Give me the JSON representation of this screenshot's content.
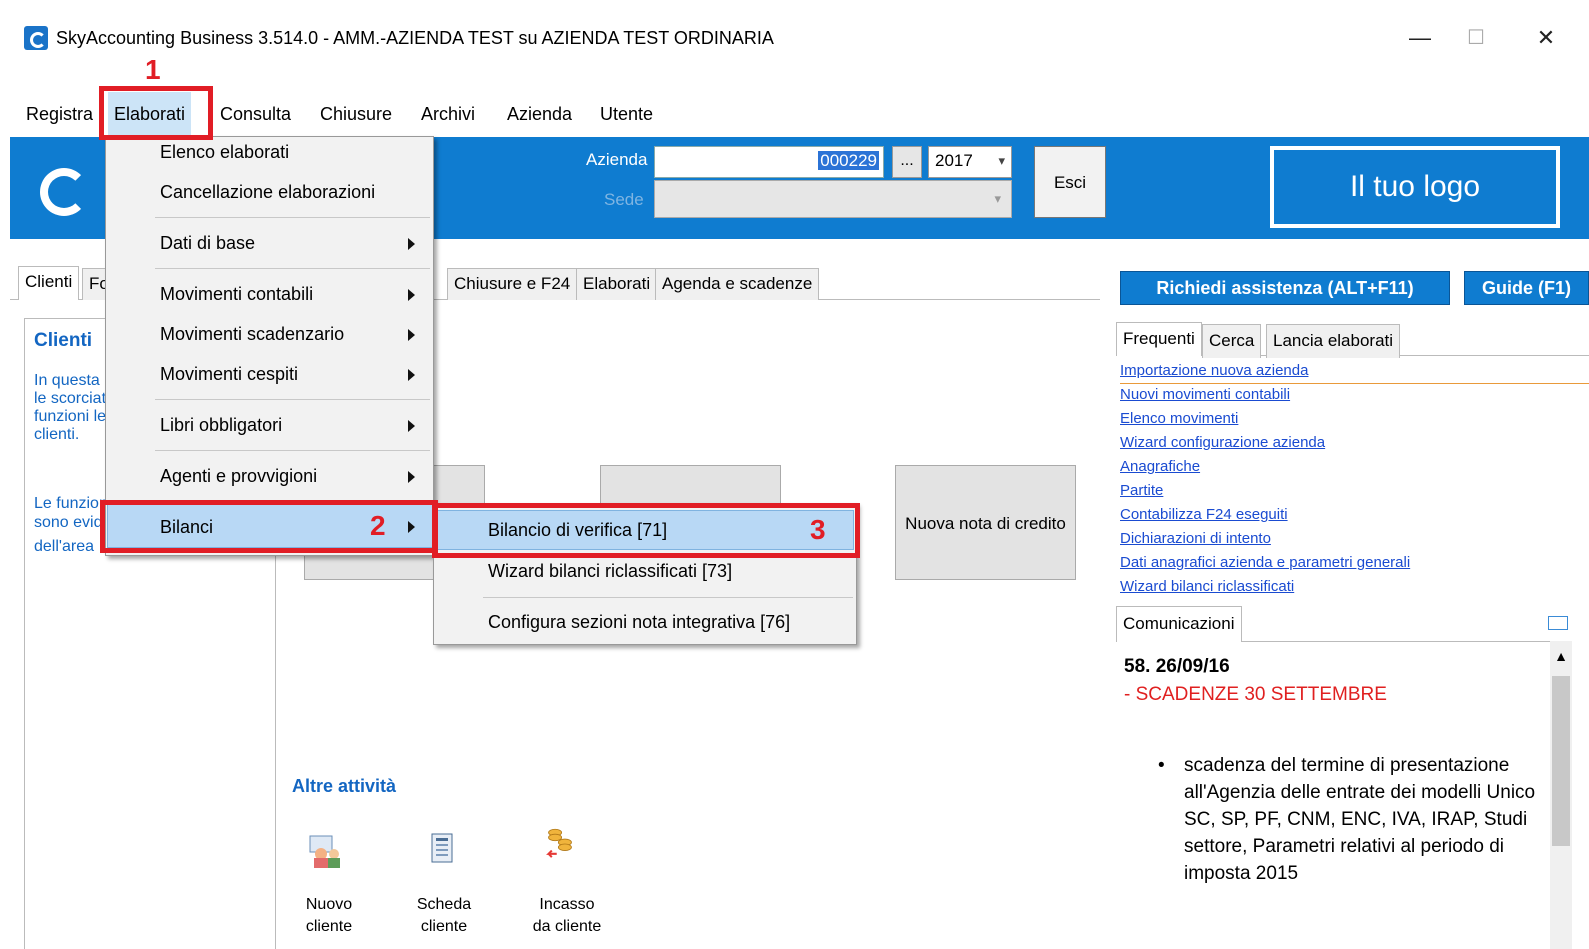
{
  "window": {
    "title": "SkyAccounting Business 3.514.0 - AMM.-AZIENDA TEST su AZIENDA TEST ORDINARIA",
    "minimize": "—",
    "maximize": "☐",
    "close": "✕"
  },
  "menubar": [
    "Registra",
    "Elaborati",
    "Consulta",
    "Chiusure",
    "Archivi",
    "Azienda",
    "Utente"
  ],
  "header": {
    "azienda_label": "Azienda",
    "azienda_value": "000229",
    "dots": "...",
    "year": "2017",
    "sede_label": "Sede",
    "esci": "Esci",
    "logo_text": "Il tuo logo"
  },
  "tabs": {
    "clienti": "Clienti",
    "fo": "Fo",
    "chiusure": "Chiusure e F24",
    "elaborati": "Elaborati",
    "agenda": "Agenda e scadenze"
  },
  "clienti_panel": {
    "heading": "Clienti",
    "lines": [
      "In questa",
      "le scorciat",
      "funzioni le",
      "clienti.",
      "",
      "Le funzion",
      "sono evid",
      "dell'area"
    ]
  },
  "tiles": {
    "nota_credito": "Nuova nota di credito"
  },
  "altre": {
    "heading": "Altre attività",
    "items": [
      {
        "line1": "Nuovo",
        "line2": "cliente"
      },
      {
        "line1": "Scheda",
        "line2": "cliente"
      },
      {
        "line1": "Incasso",
        "line2": "da cliente"
      }
    ]
  },
  "right": {
    "assistenza": "Richiedi assistenza  (ALT+F11)",
    "guide": "Guide (F1)",
    "tabs": [
      "Frequenti",
      "Cerca",
      "Lancia elaborati"
    ],
    "links": [
      "Importazione nuova azienda",
      "Nuovi movimenti contabili",
      "Elenco movimenti",
      "Wizard configurazione azienda",
      "Anagrafiche",
      "Partite",
      "Contabilizza F24 eseguiti",
      "Dichiarazioni di intento",
      "Dati anagrafici azienda e parametri generali",
      "Wizard bilanci riclassificati"
    ],
    "comunicazioni_tab": "Comunicazioni",
    "com_date": "58. 26/09/16",
    "com_subtitle": "- SCADENZE 30 SETTEMBRE",
    "com_bullet": "•",
    "com_body": "scadenza del termine di presentazione all'Agenzia delle entrate dei modelli Unico SC, SP, PF, CNM, ENC, IVA, IRAP, Studi settore, Parametri relativi al periodo di imposta 2015"
  },
  "elaborati_menu": {
    "items": [
      {
        "label": "Elenco elaborati",
        "submenu": false
      },
      {
        "label": "Cancellazione elaborazioni",
        "submenu": false
      },
      {
        "label": "Dati di base",
        "submenu": true
      },
      {
        "label": "Movimenti contabili",
        "submenu": true
      },
      {
        "label": "Movimenti scadenzario",
        "submenu": true
      },
      {
        "label": "Movimenti cespiti",
        "submenu": true
      },
      {
        "label": "Libri obbligatori",
        "submenu": true
      },
      {
        "label": "Agenti e provvigioni",
        "submenu": true
      },
      {
        "label": "Bilanci",
        "submenu": true
      }
    ]
  },
  "bilanci_menu": {
    "items": [
      "Bilancio di verifica [71]",
      "Wizard bilanci riclassificati [73]",
      "Configura sezioni nota integrativa [76]"
    ]
  },
  "annotations": [
    "1",
    "2",
    "3"
  ],
  "colors": {
    "accent_blue": "#0f7cd0",
    "annotation_red": "#e11d25",
    "menu_highlight": "#b8d8f5",
    "link_blue": "#1a4bd1"
  }
}
